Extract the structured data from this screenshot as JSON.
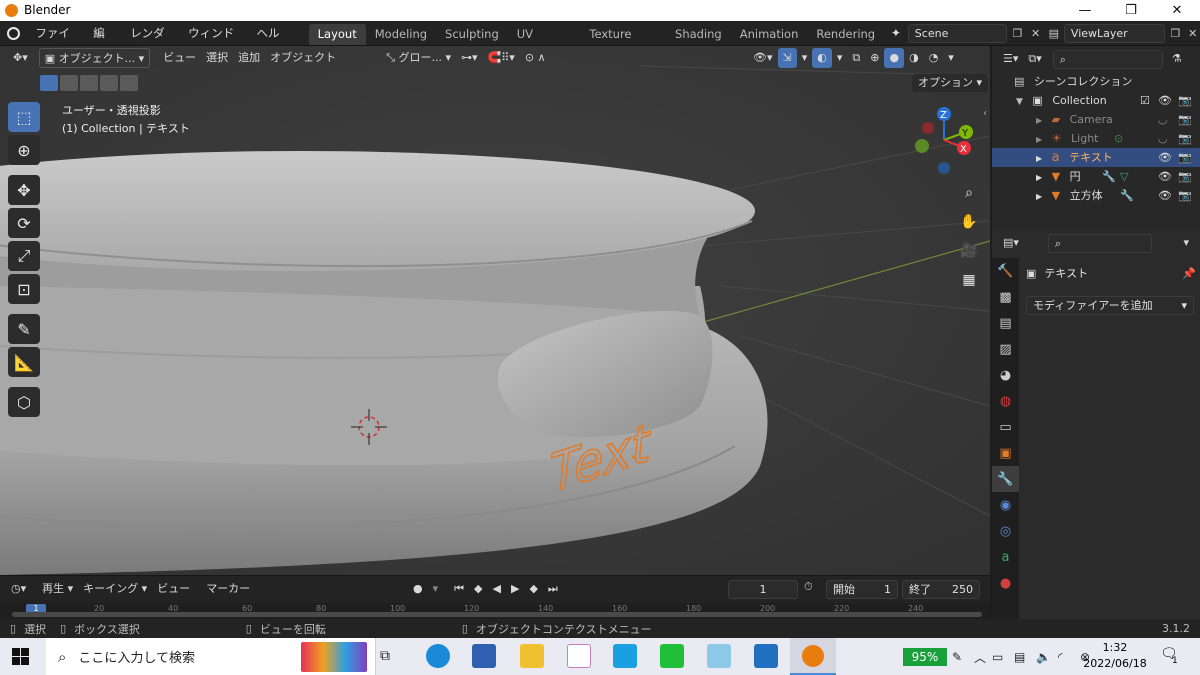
{
  "window": {
    "app_title": "Blender",
    "min": "—",
    "restore": "❐",
    "close": "✕"
  },
  "menu": [
    "ファイル",
    "編集",
    "レンダー",
    "ウィンドウ",
    "ヘルプ"
  ],
  "workspaces": [
    "Layout",
    "Modeling",
    "Sculpting",
    "UV Editing",
    "Texture Paint",
    "Shading",
    "Animation",
    "Rendering"
  ],
  "active_workspace": "Layout",
  "scene": "Scene",
  "view_layer": "ViewLayer",
  "viewport_header": {
    "mode": "オブジェクト...",
    "view": "ビュー",
    "select": "選択",
    "add": "追加",
    "object": "オブジェクト",
    "transform": "グロー...",
    "options": "オプション"
  },
  "viewport_info": {
    "perspective": "ユーザー・透視投影",
    "collection_line": "(1) Collection | テキスト"
  },
  "viewport_text_object": "Text",
  "gizmo_axes": {
    "x": "X",
    "y": "Y",
    "z": "Z"
  },
  "timeline": {
    "playback": "再生",
    "keying": "キーイング",
    "view": "ビュー",
    "marker": "マーカー",
    "current_frame": "1",
    "start_label": "開始",
    "start": "1",
    "end_label": "終了",
    "end": "250",
    "current_marker": "1",
    "ruler": [
      "20",
      "40",
      "60",
      "80",
      "100",
      "120",
      "140",
      "160",
      "180",
      "200",
      "220",
      "240"
    ]
  },
  "status": {
    "select": "選択",
    "box_select": "ボックス選択",
    "rotate_view": "ビューを回転",
    "context_menu": "オブジェクトコンテクストメニュー",
    "version": "3.1.2"
  },
  "outliner": {
    "scene_collection": "シーンコレクション",
    "items": [
      {
        "name": "Collection",
        "icon": "collection-icon"
      },
      {
        "name": "Camera",
        "icon": "camera-icon"
      },
      {
        "name": "Light",
        "icon": "light-icon"
      },
      {
        "name": "テキスト",
        "icon": "text-icon"
      },
      {
        "name": "円",
        "icon": "mesh-icon"
      },
      {
        "name": "立方体",
        "icon": "mesh-icon"
      }
    ]
  },
  "properties": {
    "object_name": "テキスト",
    "add_modifier": "モディファイアーを追加"
  },
  "taskbar": {
    "search_placeholder": "ここに入力して検索",
    "battery": "95%",
    "time": "1:32",
    "date": "2022/06/18",
    "notification_count": "1"
  },
  "colors": {
    "accent": "#4772b3",
    "selection": "#334d80",
    "text_object_outline": "#e07b2a",
    "viewport_bg": "#3a3a3a"
  }
}
